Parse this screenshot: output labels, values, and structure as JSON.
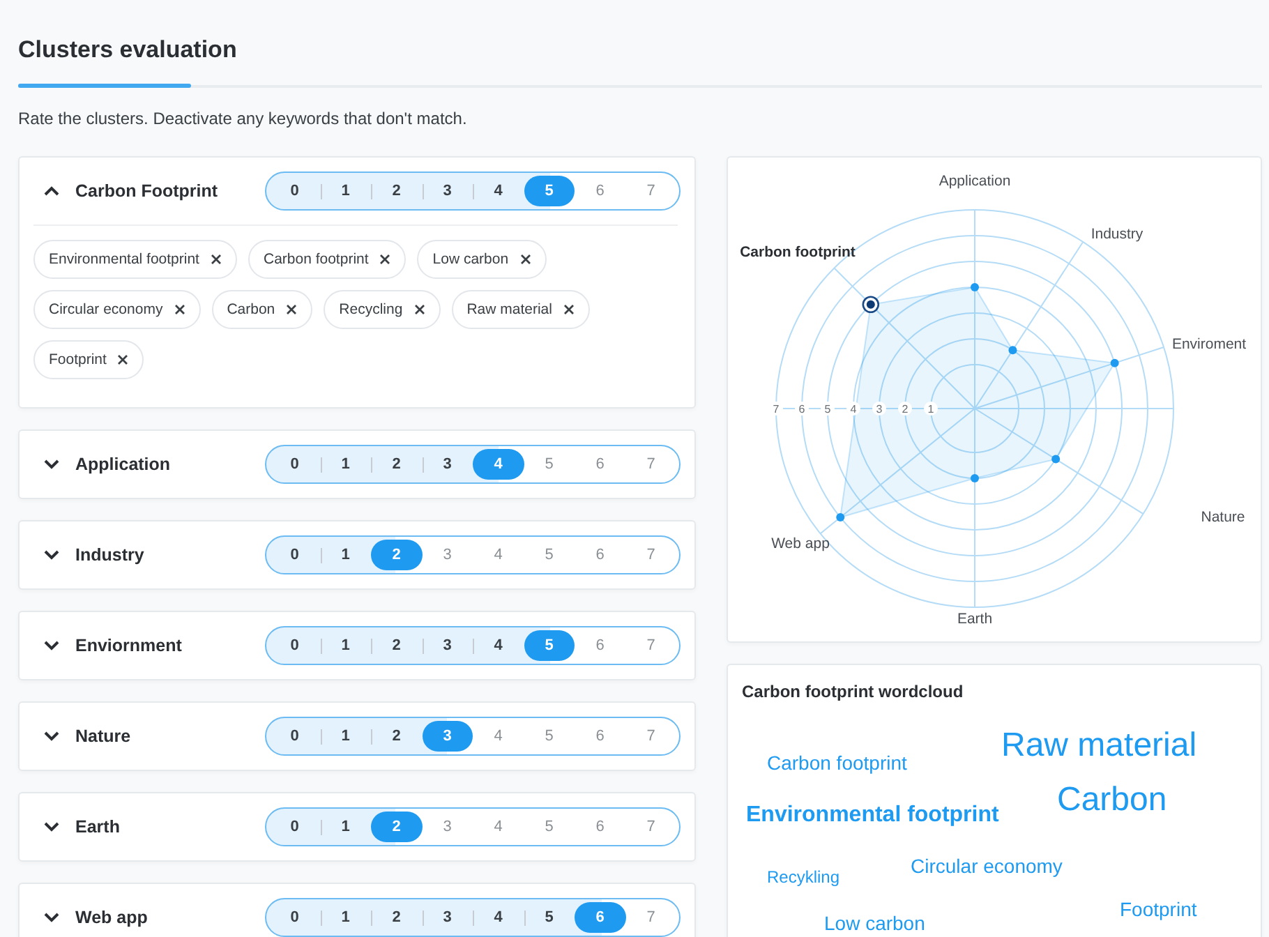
{
  "title": "Clusters evaluation",
  "subtitle": "Rate the clusters. Deactivate any keywords that don't match.",
  "clusters": [
    {
      "name": "Carbon Footprint",
      "expanded": true,
      "rating": [
        {
          "label": "0",
          "selected": false
        },
        {
          "label": "1",
          "selected": false
        },
        {
          "label": "2",
          "selected": false
        },
        {
          "label": "3",
          "selected": false
        },
        {
          "label": "4",
          "selected": false
        },
        {
          "label": "5",
          "selected": true
        },
        {
          "label": "6",
          "selected": false
        },
        {
          "label": "7",
          "selected": false
        }
      ],
      "keywords": [
        "Environmental footprint",
        "Carbon footprint",
        "Low carbon",
        "Circular economy",
        "Carbon",
        "Recycling",
        "Raw material",
        "Footprint"
      ]
    },
    {
      "name": "Application",
      "expanded": false,
      "rating": [
        {
          "label": "0",
          "selected": false
        },
        {
          "label": "1",
          "selected": false
        },
        {
          "label": "2",
          "selected": false
        },
        {
          "label": "3",
          "selected": false
        },
        {
          "label": "4",
          "selected": true
        },
        {
          "label": "5",
          "selected": false
        },
        {
          "label": "6",
          "selected": false
        },
        {
          "label": "7",
          "selected": false
        }
      ]
    },
    {
      "name": "Industry",
      "expanded": false,
      "rating": [
        {
          "label": "0",
          "selected": false
        },
        {
          "label": "1",
          "selected": false
        },
        {
          "label": "2",
          "selected": true
        },
        {
          "label": "3",
          "selected": false
        },
        {
          "label": "4",
          "selected": false
        },
        {
          "label": "5",
          "selected": false
        },
        {
          "label": "6",
          "selected": false
        },
        {
          "label": "7",
          "selected": false
        }
      ]
    },
    {
      "name": "Enviornment",
      "expanded": false,
      "rating": [
        {
          "label": "0",
          "selected": false
        },
        {
          "label": "1",
          "selected": false
        },
        {
          "label": "2",
          "selected": false
        },
        {
          "label": "3",
          "selected": false
        },
        {
          "label": "4",
          "selected": false
        },
        {
          "label": "5",
          "selected": true
        },
        {
          "label": "6",
          "selected": false
        },
        {
          "label": "7",
          "selected": false
        }
      ]
    },
    {
      "name": "Nature",
      "expanded": false,
      "rating": [
        {
          "label": "0",
          "selected": false
        },
        {
          "label": "1",
          "selected": false
        },
        {
          "label": "2",
          "selected": false
        },
        {
          "label": "3",
          "selected": true
        },
        {
          "label": "4",
          "selected": false
        },
        {
          "label": "5",
          "selected": false
        },
        {
          "label": "6",
          "selected": false
        },
        {
          "label": "7",
          "selected": false
        }
      ]
    },
    {
      "name": "Earth",
      "expanded": false,
      "rating": [
        {
          "label": "0",
          "selected": false
        },
        {
          "label": "1",
          "selected": false
        },
        {
          "label": "2",
          "selected": true
        },
        {
          "label": "3",
          "selected": false
        },
        {
          "label": "4",
          "selected": false
        },
        {
          "label": "5",
          "selected": false
        },
        {
          "label": "6",
          "selected": false
        },
        {
          "label": "7",
          "selected": false
        }
      ]
    },
    {
      "name": "Web app",
      "expanded": false,
      "rating": [
        {
          "label": "0",
          "selected": false
        },
        {
          "label": "1",
          "selected": false
        },
        {
          "label": "2",
          "selected": false
        },
        {
          "label": "3",
          "selected": false
        },
        {
          "label": "4",
          "selected": false
        },
        {
          "label": "5",
          "selected": false
        },
        {
          "label": "6",
          "selected": true
        },
        {
          "label": "7",
          "selected": false
        }
      ]
    }
  ],
  "radar": {
    "axes": [
      {
        "label": "Application",
        "highlighted": false
      },
      {
        "label": "Industry",
        "highlighted": false
      },
      {
        "label": "Enviroment",
        "highlighted": false
      },
      {
        "label": "Nature",
        "highlighted": false
      },
      {
        "label": "Earth",
        "highlighted": false
      },
      {
        "label": "Web app",
        "highlighted": false
      },
      {
        "label": "Carbon footprint",
        "highlighted": true
      }
    ],
    "scale_labels": [
      "7",
      "6",
      "5",
      "4",
      "3",
      "2",
      "1"
    ]
  },
  "wordcloud": {
    "title": "Carbon footprint wordcloud",
    "words": [
      {
        "text": "Carbon footprint",
        "kind": "medium",
        "bold": false
      },
      {
        "text": "Raw material",
        "kind": "large",
        "bold": false
      },
      {
        "text": "Carbon",
        "kind": "large",
        "bold": false
      },
      {
        "text": "Environmental footprint",
        "kind": "medium",
        "bold": true
      },
      {
        "text": "Circular economy",
        "kind": "medium",
        "bold": false
      },
      {
        "text": "Recykling",
        "kind": "small",
        "bold": false
      },
      {
        "text": "Footprint",
        "kind": "medium",
        "bold": false
      },
      {
        "text": "Low carbon",
        "kind": "medium",
        "bold": false
      }
    ]
  }
}
